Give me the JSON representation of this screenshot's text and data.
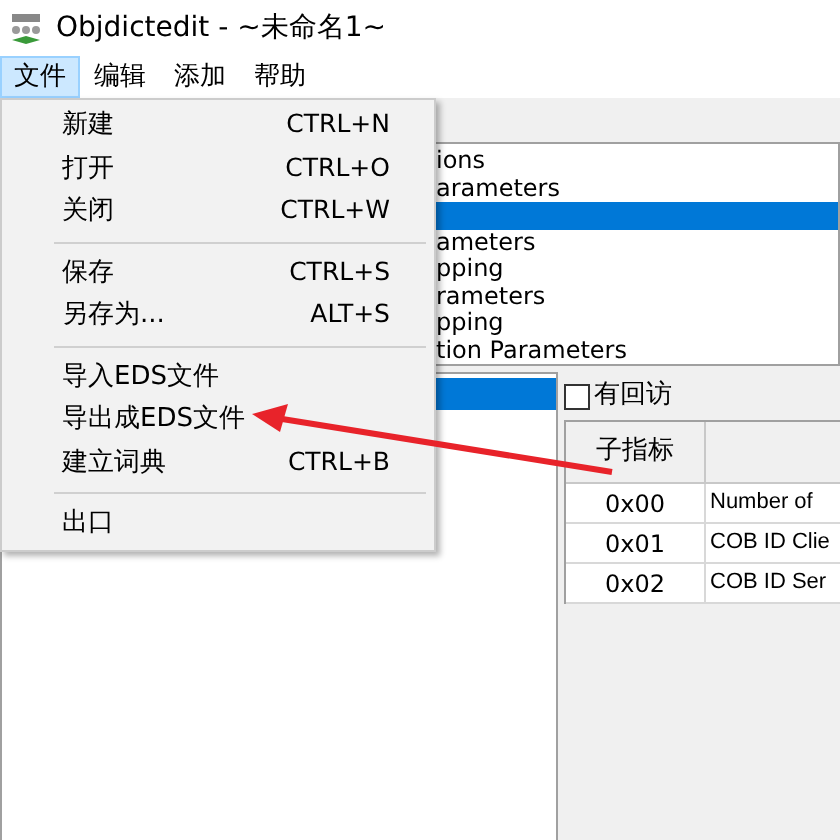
{
  "window": {
    "title": "Objdictedit - ~未命名1~"
  },
  "menubar": [
    {
      "label": "文件",
      "selected": true
    },
    {
      "label": "编辑",
      "selected": false
    },
    {
      "label": "添加",
      "selected": false
    },
    {
      "label": "帮助",
      "selected": false
    }
  ],
  "file_menu": [
    {
      "kind": "item",
      "label": "新建",
      "shortcut": "CTRL+N"
    },
    {
      "kind": "item",
      "label": "打开",
      "shortcut": "CTRL+O"
    },
    {
      "kind": "item",
      "label": "关闭",
      "shortcut": "CTRL+W"
    },
    {
      "kind": "separator"
    },
    {
      "kind": "item",
      "label": "保存",
      "shortcut": "CTRL+S"
    },
    {
      "kind": "item",
      "label": "另存为...",
      "shortcut": "ALT+S"
    },
    {
      "kind": "separator"
    },
    {
      "kind": "item",
      "label": "导入EDS文件"
    },
    {
      "kind": "item",
      "label": "导出成EDS文件"
    },
    {
      "kind": "item",
      "label": "建立词典",
      "shortcut": "CTRL+B"
    },
    {
      "kind": "separator"
    },
    {
      "kind": "item",
      "label": "出口"
    }
  ],
  "index_list": [
    {
      "label": "ions",
      "selected": false
    },
    {
      "label": "arameters",
      "selected": false
    },
    {
      "selected": true
    },
    {
      "label": "ameters",
      "selected": false
    },
    {
      "label": "pping",
      "selected": false
    },
    {
      "label": "rameters",
      "selected": false
    },
    {
      "label": "pping",
      "selected": false
    },
    {
      "label": "tion Parameters",
      "selected": false
    }
  ],
  "subindex_list": [
    {
      "selected": true
    }
  ],
  "callback_checkbox": {
    "label": "有回访",
    "checked": false
  },
  "table": {
    "columns": [
      "子指标"
    ],
    "rows": [
      [
        "0x00",
        "Number of"
      ],
      [
        "0x01",
        "COB ID Clie"
      ],
      [
        "0x02",
        "COB ID Ser"
      ]
    ]
  }
}
